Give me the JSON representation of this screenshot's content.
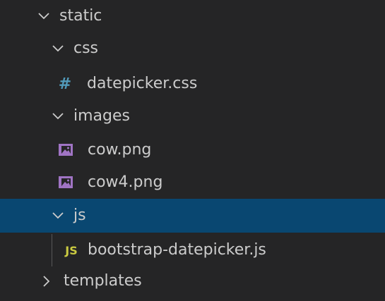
{
  "explorer": {
    "items": [
      {
        "label": "static",
        "kind": "folder",
        "expanded": true
      },
      {
        "label": "css",
        "kind": "folder",
        "expanded": true
      },
      {
        "label": "datepicker.css",
        "kind": "file",
        "icon": "css-hash-icon",
        "icon_glyph": "#"
      },
      {
        "label": "images",
        "kind": "folder",
        "expanded": true
      },
      {
        "label": "cow.png",
        "kind": "file",
        "icon": "image-file-icon"
      },
      {
        "label": "cow4.png",
        "kind": "file",
        "icon": "image-file-icon"
      },
      {
        "label": "js",
        "kind": "folder",
        "expanded": true,
        "selected": true
      },
      {
        "label": "bootstrap-datepicker.js",
        "kind": "file",
        "icon": "js-file-icon",
        "icon_glyph": "JS"
      },
      {
        "label": "templates",
        "kind": "folder",
        "expanded": false
      }
    ]
  },
  "colors": {
    "background": "#252526",
    "selection": "#094771",
    "text": "#cccccc",
    "css_icon": "#519aba",
    "js_icon": "#cbcb41",
    "image_icon": "#a074c4"
  }
}
